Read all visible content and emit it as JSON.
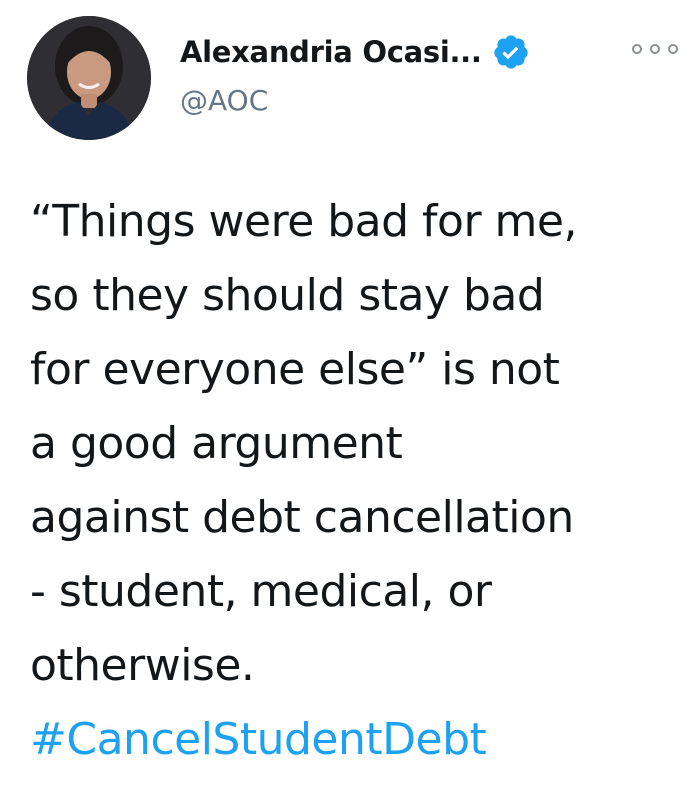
{
  "author": {
    "display_name": "Alexandria Ocasi...",
    "handle": "@AOC",
    "verified_icon": "verified-badge-icon",
    "avatar_icon": "profile-photo"
  },
  "tweet": {
    "lines": [
      "“Things were bad for me,",
      "so they should stay bad",
      "for everyone else” is not",
      "a good argument",
      "against debt cancellation",
      "- student, medical, or",
      "otherwise."
    ],
    "hashtag": "#CancelStudentDebt"
  },
  "colors": {
    "text": "#14171a",
    "secondary": "#657786",
    "link": "#1da1f2",
    "verified": "#1da1f2"
  },
  "more_icon": "more-options-icon"
}
